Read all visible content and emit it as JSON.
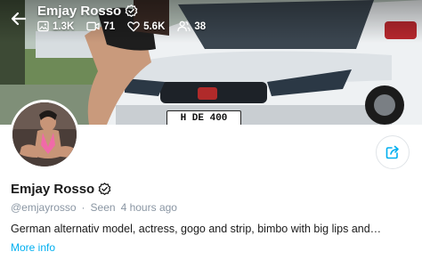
{
  "profile": {
    "display_name": "Emjay Rosso",
    "username": "@emjayrosso",
    "seen_label": "Seen",
    "seen_time": "4 hours ago",
    "bio": "German alternativ model, actress, gogo and strip, bimbo with big lips and…",
    "more_label": "More info"
  },
  "stats": {
    "photos": "1.3K",
    "videos": "71",
    "likes": "5.6K",
    "fans": "38"
  },
  "cover": {
    "license_plate": "H DE 400"
  },
  "colors": {
    "accent": "#00aff0",
    "muted_text": "#8a96a3"
  },
  "icons": {
    "back": "arrow-left-icon",
    "verified": "verified-badge-icon",
    "photos": "image-icon",
    "videos": "video-icon",
    "likes": "heart-icon",
    "fans": "users-icon",
    "share": "share-icon"
  }
}
